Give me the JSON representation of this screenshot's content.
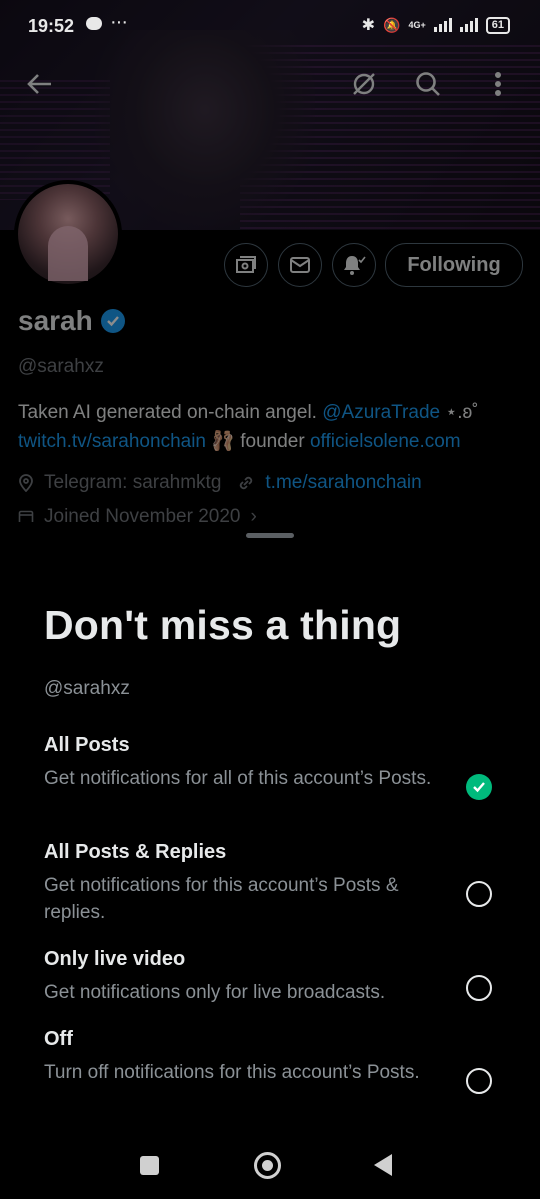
{
  "status_bar": {
    "time": "19:52",
    "network": "4G+",
    "battery": "61"
  },
  "profile": {
    "name": "sarah",
    "handle": "@sarahxz",
    "follow_label": "Following",
    "bio_line1_text": "Taken AI generated on-chain angel. ",
    "bio_line1_mention": "@AzuraTrade",
    "bio_line1_tail": " ⋆.ʚ˚",
    "bio_line2_link": "twitch.tv/sarahonchain",
    "bio_line2_emoji": "🩰",
    "bio_line2_text": " founder ",
    "bio_line2_site": "officielsolene.com",
    "location": "Telegram: sarahmktg",
    "website": "t.me/sarahonchain",
    "joined": "Joined November 2020"
  },
  "sheet": {
    "title": "Don't miss a thing",
    "handle": "@sarahxz",
    "options": [
      {
        "title": "All Posts",
        "desc": "Get notifications for all of this account’s Posts.",
        "selected": true
      },
      {
        "title": "All Posts & Replies",
        "desc": "Get notifications for this account’s Posts & replies.",
        "selected": false
      },
      {
        "title": "Only live video",
        "desc": "Get notifications only for live broadcasts.",
        "selected": false
      },
      {
        "title": "Off",
        "desc": "Turn off notifications for this account’s Posts.",
        "selected": false
      }
    ]
  },
  "colors": {
    "accent": "#1d9bf0",
    "selected": "#00ba7c",
    "muted": "#71767b"
  }
}
